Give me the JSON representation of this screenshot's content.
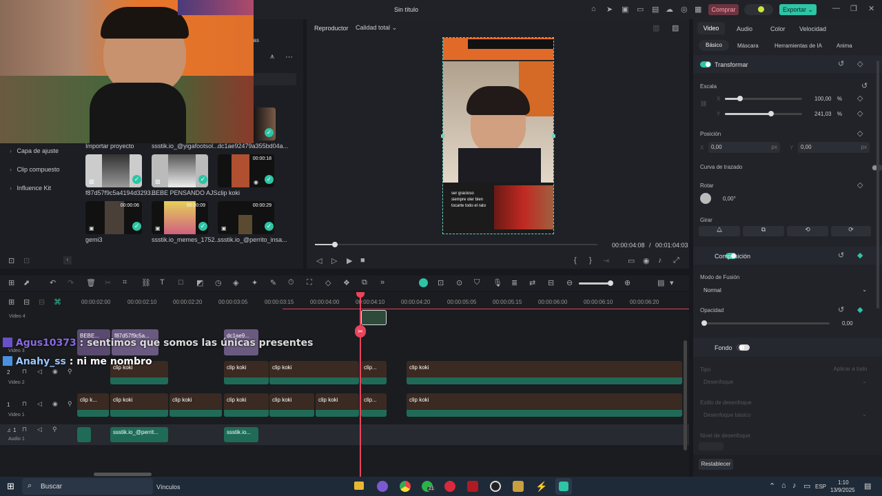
{
  "app": {
    "title": "Sin título",
    "buy_label": "Comprar",
    "credits": "0",
    "export_label": "Exportar"
  },
  "media": {
    "sidebar": [
      "Capa de ajuste",
      "Clip compuesto",
      "Influence Kit"
    ],
    "partial_label": "llas",
    "items": [
      {
        "name": "Importar proyecto",
        "duration": ""
      },
      {
        "name": "ssstik.io_@yigafootsol...",
        "duration": ""
      },
      {
        "name": "dc1ae92479a355bd04a...",
        "duration": ""
      },
      {
        "name": "f87d57f9c5a4194d3293...",
        "duration": ""
      },
      {
        "name": "BEBE PENSANDO AJS...",
        "duration": ""
      },
      {
        "name": "clip koki",
        "duration": "00:00:18"
      },
      {
        "name": "gemi3",
        "duration": "00:00:06"
      },
      {
        "name": "ssstik.io_memes_1752...",
        "duration": "00:00:09"
      },
      {
        "name": "ssstik.io_@perrito_insa...",
        "duration": "00:00:29"
      }
    ]
  },
  "player": {
    "label": "Reproductor",
    "quality": "Calidad total",
    "current_time": "00:00:04:08",
    "separator": "/",
    "total_time": "00:01:04:03",
    "progress": 0.07,
    "caption_lines": [
      "ser gracioso",
      "siempre oler bien",
      "tocarte todo el rato"
    ]
  },
  "props": {
    "tabs": [
      "Video",
      "Audio",
      "Color",
      "Velocidad"
    ],
    "subtabs": [
      "Básico",
      "Máscara",
      "Herramientas de IA",
      "Anima"
    ],
    "transform": "Transformar",
    "scale": "Escala",
    "x_axis": "X",
    "y_axis": "Y",
    "scale_x": "100,00",
    "scale_y": "241,03",
    "scale_x_level": 0.2,
    "scale_y_level": 0.6,
    "percent": "%",
    "position": "Posición",
    "pos_x": "0,00",
    "pos_y": "0,00",
    "px": "px",
    "path_curve": "Curva de trazado",
    "rotate": "Rotar",
    "rotate_val": "0,00°",
    "flip": "Girar",
    "composition": "Composición",
    "blend_mode": "Modo de Fusión",
    "blend_value": "Normal",
    "opacity": "Opacidad",
    "opacity_val": "0,00",
    "background": "Fondo",
    "type": "Tipo",
    "apply_all": "Aplicar a todo",
    "blur": "Desenfoque",
    "blur_style": "Estilo de desenfoque",
    "blur_basic": "Desenfoque básico",
    "blur_level": "Nivel de desenfoque",
    "reset": "Restablecer"
  },
  "timeline": {
    "ticks": [
      "00:00:02:00",
      "00:00:02:10",
      "00:00:02:20",
      "00:00:03:05",
      "00:00:03:15",
      "00:00:04:00",
      "00:00:04:10",
      "00:00:04:20",
      "00:00:05:05",
      "00:00:05:15",
      "00:00:06:00",
      "00:00:06:10",
      "00:00:06:20"
    ],
    "tracks": [
      {
        "name": "Video 4",
        "num": ""
      },
      {
        "name": "Video 3",
        "num": "3"
      },
      {
        "name": "Video 2",
        "num": "2"
      },
      {
        "name": "Video 1",
        "num": "1"
      },
      {
        "name": "Audio 1",
        "num": "1"
      }
    ],
    "clip_label": "clip koki",
    "clip_short": "clip k...",
    "clip_cut": "clip...",
    "v3_clips": [
      "BEBE...",
      "f87d57f9c5a...",
      "dc1ae9..."
    ],
    "audio_clips": [
      "ssstik.io_@perrit...",
      "ssstik.io..."
    ]
  },
  "chat": [
    {
      "user": "Agus10373",
      "msg": "sentimos que somos las únicas presentes"
    },
    {
      "user": "Anahy_ss",
      "msg": "ni me nombro"
    }
  ],
  "taskbar": {
    "search": "Buscar",
    "links": "Vínculos",
    "badge": "21",
    "lang": "ESP",
    "time": "1:10",
    "date": "13/9/2025"
  }
}
